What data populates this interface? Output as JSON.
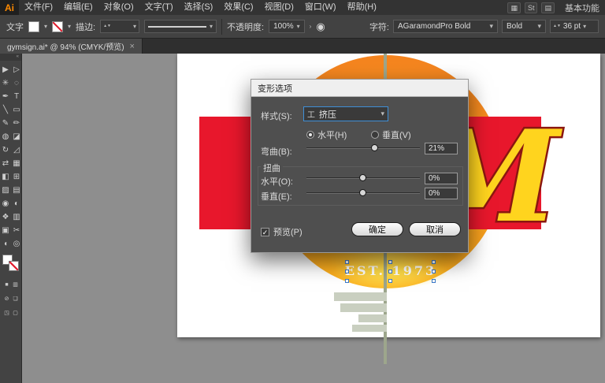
{
  "menu_bar": {
    "logo": "Ai",
    "items": [
      {
        "name": "file",
        "label": "文件(F)"
      },
      {
        "name": "edit",
        "label": "编辑(E)"
      },
      {
        "name": "object",
        "label": "对象(O)"
      },
      {
        "name": "type",
        "label": "文字(T)"
      },
      {
        "name": "select",
        "label": "选择(S)"
      },
      {
        "name": "effect",
        "label": "效果(C)"
      },
      {
        "name": "view",
        "label": "视图(D)"
      },
      {
        "name": "window",
        "label": "窗口(W)"
      },
      {
        "name": "help",
        "label": "帮助(H)"
      }
    ],
    "icons": [
      {
        "name": "bridge-icon",
        "glyph": "▦"
      },
      {
        "name": "stock-icon",
        "glyph": "St"
      },
      {
        "name": "arrange-documents-icon",
        "glyph": "▤"
      }
    ],
    "workspace": "基本功能"
  },
  "control_bar": {
    "context_label": "文字",
    "stroke_label": "描边:",
    "stroke_value": "",
    "opacity_label": "不透明度:",
    "opacity_value": "100%",
    "character_label": "字符:",
    "font_name": "AGaramondPro Bold",
    "font_style": "Bold",
    "font_size": "36 pt"
  },
  "tab": {
    "title": "gymsign.ai* @ 94% (CMYK/预览)",
    "close": "×"
  },
  "tools": [
    {
      "name": "selection",
      "glyph": "▶"
    },
    {
      "name": "direct-selection",
      "glyph": "▷"
    },
    {
      "name": "magic-wand",
      "glyph": "✳"
    },
    {
      "name": "lasso",
      "glyph": "◌"
    },
    {
      "name": "pen",
      "glyph": "✒"
    },
    {
      "name": "type",
      "glyph": "T"
    },
    {
      "name": "line-segment",
      "glyph": "╲"
    },
    {
      "name": "rectangle",
      "glyph": "▭"
    },
    {
      "name": "paintbrush",
      "glyph": "✎"
    },
    {
      "name": "pencil",
      "glyph": "✏"
    },
    {
      "name": "blob-brush",
      "glyph": "◍"
    },
    {
      "name": "eraser",
      "glyph": "◪"
    },
    {
      "name": "rotate",
      "glyph": "↻"
    },
    {
      "name": "scale",
      "glyph": "◿"
    },
    {
      "name": "width",
      "glyph": "⇄"
    },
    {
      "name": "free-transform",
      "glyph": "▦"
    },
    {
      "name": "shape-builder",
      "glyph": "◧"
    },
    {
      "name": "perspective-grid",
      "glyph": "⊞"
    },
    {
      "name": "mesh",
      "glyph": "▨"
    },
    {
      "name": "gradient",
      "glyph": "▤"
    },
    {
      "name": "eyedropper",
      "glyph": "◉"
    },
    {
      "name": "blend",
      "glyph": "◐"
    },
    {
      "name": "symbol-sprayer",
      "glyph": "❖"
    },
    {
      "name": "column-graph",
      "glyph": "▥"
    },
    {
      "name": "artboard",
      "glyph": "▣"
    },
    {
      "name": "slice",
      "glyph": "✂"
    },
    {
      "name": "hand",
      "glyph": "◖"
    },
    {
      "name": "zoom",
      "glyph": "◎"
    }
  ],
  "tool_footer": [
    {
      "name": "color-fill-icon",
      "glyph": "■"
    },
    {
      "name": "gradient-swatch-icon",
      "glyph": "▥"
    },
    {
      "name": "none-icon",
      "glyph": "⊘"
    },
    {
      "name": "draw-normal-mode-icon",
      "glyph": "❏"
    },
    {
      "name": "draw-behind-mode-icon",
      "glyph": "◳"
    },
    {
      "name": "screen-mode-icon",
      "glyph": "▢"
    }
  ],
  "dialog": {
    "title": "变形选项",
    "style_label": "样式(S):",
    "style_value": "挤压",
    "orient_horizontal": "水平(H)",
    "orient_vertical": "垂直(V)",
    "bend_label": "弯曲(B):",
    "bend_value": 21,
    "bend_display": "21%",
    "distort_label": "扭曲",
    "distort_h_label": "水平(O):",
    "distort_h_value": 0,
    "distort_h_display": "0%",
    "distort_v_label": "垂直(E):",
    "distort_v_value": 0,
    "distort_v_display": "0%",
    "preview_label": "预览(P)",
    "ok_label": "确定",
    "cancel_label": "取消"
  },
  "artwork": {
    "est_text": "EST. 1973",
    "monogram": "M"
  },
  "colors": {
    "accent_blue": "#3f8fd6",
    "band_red": "#e8172c",
    "circle_orange": "#f7941e",
    "circle_yellow": "#ffd94f",
    "monogram_yellow": "#ffd41e",
    "monogram_outline": "#8b1710",
    "line_olive": "#9da68c"
  }
}
